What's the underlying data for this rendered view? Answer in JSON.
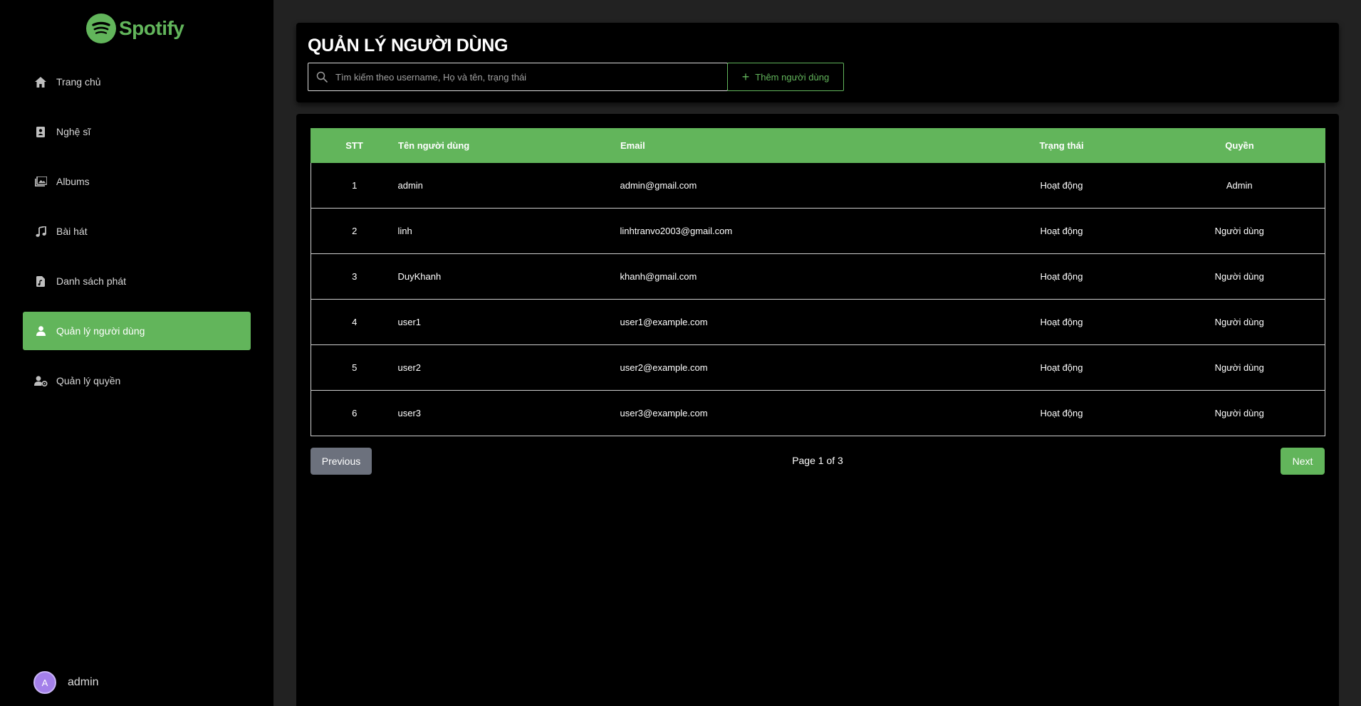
{
  "brand": {
    "name": "Spotify",
    "color": "#62b55b"
  },
  "sidebar": {
    "items": [
      {
        "label": "Trang chủ",
        "icon": "home-icon"
      },
      {
        "label": "Nghệ sĩ",
        "icon": "artist-icon"
      },
      {
        "label": "Albums",
        "icon": "albums-icon"
      },
      {
        "label": "Bài hát",
        "icon": "music-note-icon"
      },
      {
        "label": "Danh sách phát",
        "icon": "playlist-icon"
      },
      {
        "label": "Quản lý người dùng",
        "icon": "user-icon",
        "active": true
      },
      {
        "label": "Quản lý quyền",
        "icon": "user-settings-icon"
      }
    ],
    "user": {
      "initial": "A",
      "name": "admin"
    }
  },
  "header": {
    "title": "QUẢN LÝ NGƯỜI DÙNG",
    "search_placeholder": "Tìm kiếm theo username, Họ và tên, trạng thái",
    "add_button_label": "Thêm người dùng"
  },
  "table": {
    "columns": [
      "STT",
      "Tên người dùng",
      "Email",
      "Trạng thái",
      "Quyền"
    ],
    "rows": [
      [
        "1",
        "admin",
        "admin@gmail.com",
        "Hoạt động",
        "Admin"
      ],
      [
        "2",
        "linh",
        "linhtranvo2003@gmail.com",
        "Hoạt động",
        "Người dùng"
      ],
      [
        "3",
        "DuyKhanh",
        "khanh@gmail.com",
        "Hoạt động",
        "Người dùng"
      ],
      [
        "4",
        "user1",
        "user1@example.com",
        "Hoạt động",
        "Người dùng"
      ],
      [
        "5",
        "user2",
        "user2@example.com",
        "Hoạt động",
        "Người dùng"
      ],
      [
        "6",
        "user3",
        "user3@example.com",
        "Hoạt động",
        "Người dùng"
      ]
    ]
  },
  "pagination": {
    "previous_label": "Previous",
    "page_info": "Page 1 of 3",
    "next_label": "Next"
  }
}
